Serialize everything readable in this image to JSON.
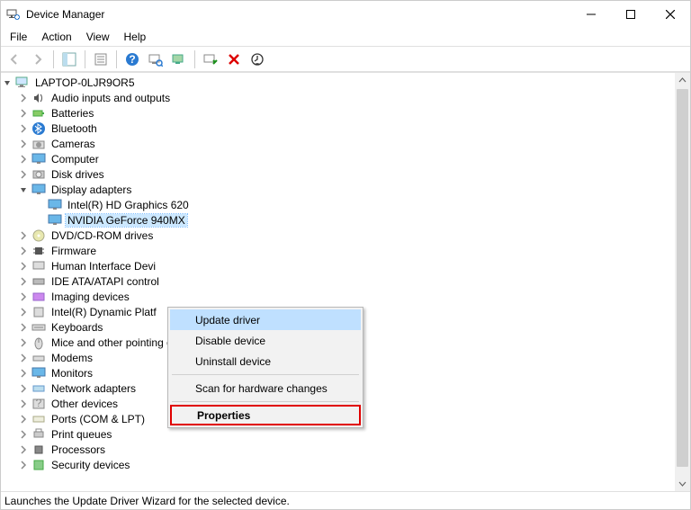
{
  "window": {
    "title": "Device Manager"
  },
  "window_buttons": {
    "minimize": "Minimize",
    "maximize": "Maximize",
    "close": "Close"
  },
  "menu": {
    "file": "File",
    "action": "Action",
    "view": "View",
    "help": "Help"
  },
  "tree": {
    "root": "LAPTOP-0LJR9OR5",
    "nodes": {
      "audio": "Audio inputs and outputs",
      "batteries": "Batteries",
      "bluetooth": "Bluetooth",
      "cameras": "Cameras",
      "computer": "Computer",
      "disk": "Disk drives",
      "display": "Display adapters",
      "display_intel": "Intel(R) HD Graphics 620",
      "display_nvidia": "NVIDIA GeForce 940MX",
      "dvd": "DVD/CD-ROM drives",
      "firmware": "Firmware",
      "hid": "Human Interface Devi",
      "ide": "IDE ATA/ATAPI control",
      "imaging": "Imaging devices",
      "intel_platf": "Intel(R) Dynamic Platf",
      "keyboards": "Keyboards",
      "mice": "Mice and other pointing devices",
      "modems": "Modems",
      "monitors": "Monitors",
      "network": "Network adapters",
      "other": "Other devices",
      "ports": "Ports (COM & LPT)",
      "print": "Print queues",
      "processors": "Processors",
      "security": "Security devices"
    }
  },
  "context_menu": {
    "update": "Update driver",
    "disable": "Disable device",
    "uninstall": "Uninstall device",
    "scan": "Scan for hardware changes",
    "properties": "Properties"
  },
  "statusbar": {
    "text": "Launches the Update Driver Wizard for the selected device."
  }
}
